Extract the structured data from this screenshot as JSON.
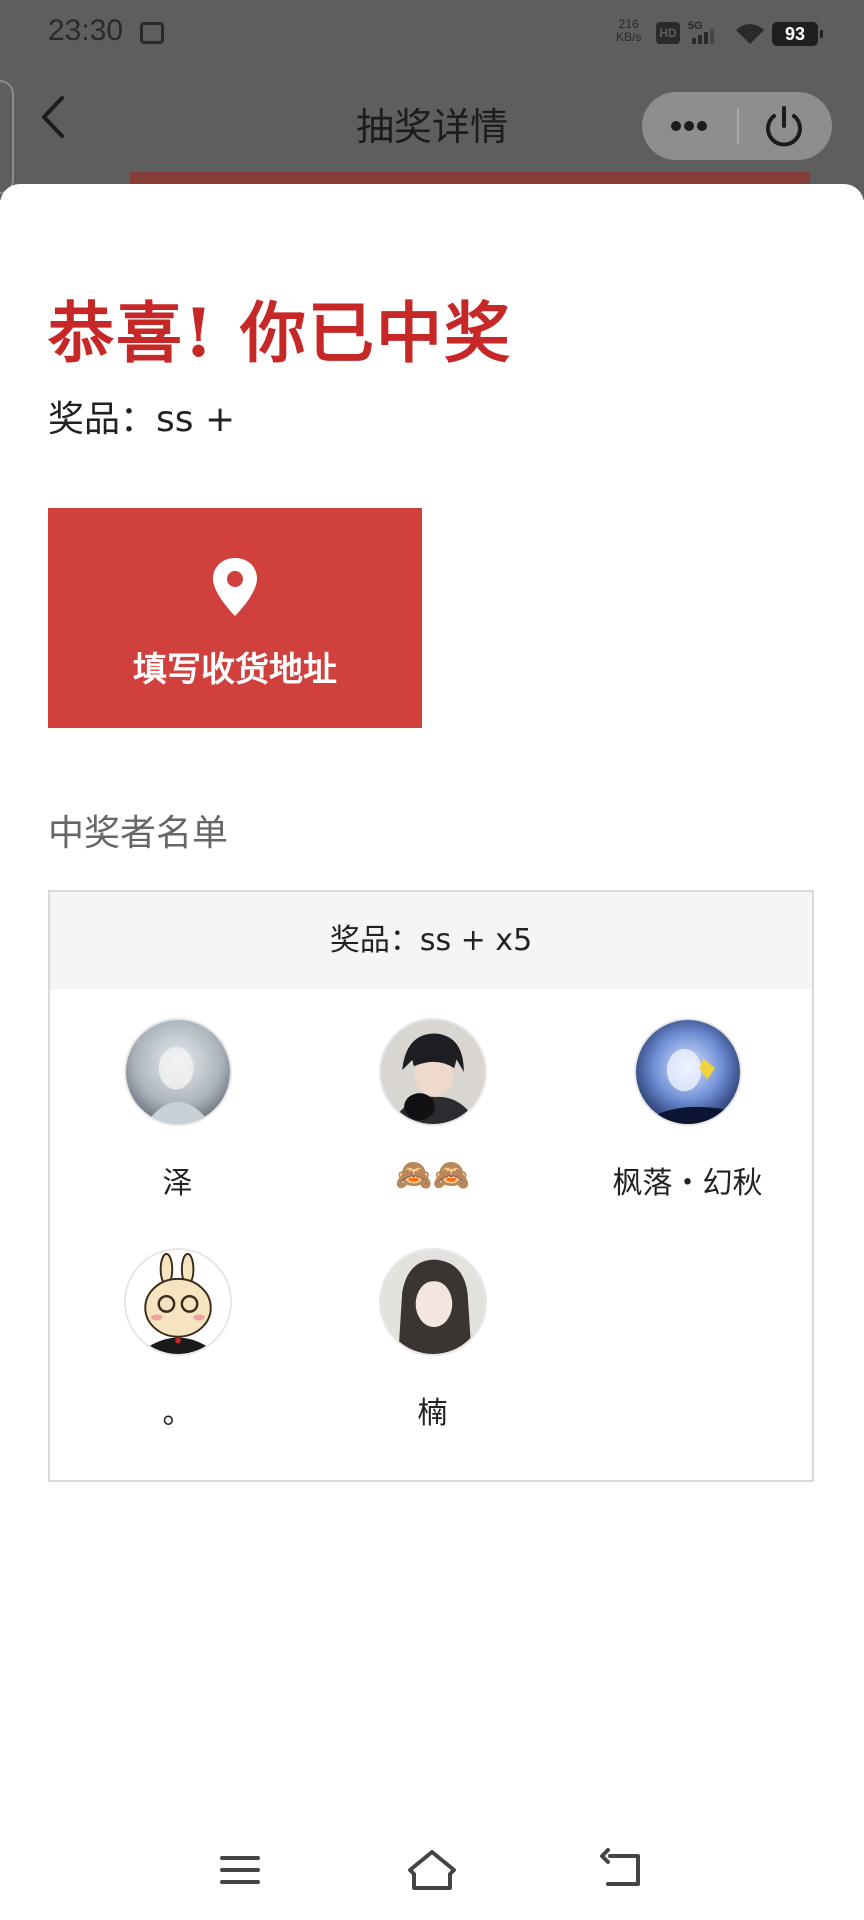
{
  "status_bar": {
    "time": "23:30",
    "net_speed_value": "216",
    "net_speed_unit": "KB/s",
    "hd_label": "HD",
    "network_label": "5G",
    "battery": "93"
  },
  "nav": {
    "title": "抽奖详情"
  },
  "result": {
    "headline": "恭喜! 你已中奖",
    "prize_line": "奖品：ss +"
  },
  "address_button": {
    "label": "填写收货地址"
  },
  "winners": {
    "heading": "中奖者名单",
    "box_header": "奖品：ss + x5",
    "list": [
      {
        "name": "泽"
      },
      {
        "name": "🙈🙈"
      },
      {
        "name": "枫落・幻秋"
      },
      {
        "name": "。"
      },
      {
        "name": "楠"
      }
    ]
  },
  "colors": {
    "accent_red": "#c62828",
    "button_red": "#d0403d"
  }
}
